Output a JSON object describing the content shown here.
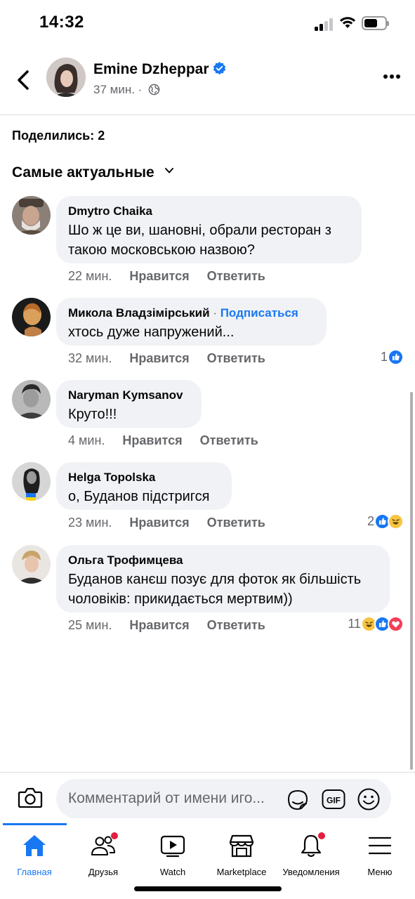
{
  "status_bar": {
    "time": "14:32"
  },
  "header": {
    "author": "Emine Dzheppar",
    "time_ago": "37 мин.",
    "separator": "·"
  },
  "shares": "Поделились: 2",
  "sort": {
    "label": "Самые актуальные"
  },
  "comments": [
    {
      "author": "Dmytro Chaika",
      "text_lines": [
        "Шо ж це ви, шановні, обрали ресторан з",
        "такою московською назвою?"
      ],
      "time": "22 мин.",
      "like": "Нравится",
      "reply": "Ответить"
    },
    {
      "author": "Микола Владзімірський",
      "follow_sep": "·",
      "follow": "Подписаться",
      "text_lines": [
        "хтось дуже напружений..."
      ],
      "time": "32 мин.",
      "like": "Нравится",
      "reply": "Ответить",
      "reaction_count": "1",
      "reactions": [
        "like"
      ]
    },
    {
      "author": "Naryman Kymsanov",
      "text_lines": [
        "Круто!!!"
      ],
      "time": "4 мин.",
      "like": "Нравится",
      "reply": "Ответить"
    },
    {
      "author": "Helga Topolska",
      "text_lines": [
        "о, Буданов підстригся"
      ],
      "time": "23 мин.",
      "like": "Нравится",
      "reply": "Ответить",
      "reaction_count": "2",
      "reactions": [
        "like",
        "haha"
      ]
    },
    {
      "author": "Ольга Трофимцева",
      "text_lines": [
        "Буданов канєш позує для фоток як більшість",
        "чоловіків: прикидається мертвим))"
      ],
      "time": "25 мин.",
      "like": "Нравится",
      "reply": "Ответить",
      "reaction_count": "11",
      "reactions": [
        "haha",
        "like",
        "love"
      ]
    }
  ],
  "composer": {
    "placeholder": "Комментарий от имени иго..."
  },
  "nav": {
    "tabs": [
      {
        "label": "Главная",
        "icon": "home-icon",
        "active": true
      },
      {
        "label": "Друзья",
        "icon": "friends-icon",
        "badge": true
      },
      {
        "label": "Watch",
        "icon": "watch-icon"
      },
      {
        "label": "Marketplace",
        "icon": "marketplace-icon"
      },
      {
        "label": "Уведомления",
        "icon": "bell-icon",
        "badge": true
      },
      {
        "label": "Меню",
        "icon": "menu-icon"
      }
    ]
  },
  "colors": {
    "accent": "#1877f2",
    "bubble": "#f0f2f5",
    "secondary_text": "#65676b",
    "badge": "#e41e3f"
  }
}
